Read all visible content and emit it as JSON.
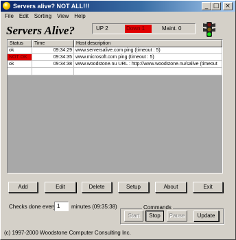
{
  "window": {
    "title": "Servers alive? NOT ALL!!!",
    "min": "_",
    "max": "□",
    "close": "×"
  },
  "menu": [
    "File",
    "Edit",
    "Sorting",
    "View",
    "Help"
  ],
  "app_title": "Servers Alive?",
  "status": {
    "up": "UP  2",
    "down": "Down 1",
    "maint": "Maint. 0",
    "down_color": "#e00000"
  },
  "list": {
    "columns": [
      "Status",
      "Time",
      "Host description"
    ],
    "rows": [
      {
        "status": "ok",
        "time": "09:34:29",
        "host": "www.serversalive.com  ping  (timeout :  5)"
      },
      {
        "status": "NOT OK",
        "time": "09:34:35",
        "host": "www.microsoft.com  ping  (timeout :  5)"
      },
      {
        "status": "ok",
        "time": "09:34:38",
        "host": "www.woodstone.nu  URL : http://www.woodstone.nu/salive  (timeout"
      }
    ]
  },
  "buttons": {
    "add": "Add",
    "edit": "Edit",
    "delete": "Delete",
    "setup": "Setup",
    "about": "About",
    "exit": "Exit"
  },
  "checks": {
    "label": "Checks done every",
    "interval": "1",
    "minutes": "minutes (09:35:38)"
  },
  "commands": {
    "label": "Commands",
    "start": "Start",
    "stop": "Stop",
    "pause": "Pause",
    "update": "Update"
  },
  "copyright": "(c) 1997-2000 Woodstone Computer Consulting Inc."
}
